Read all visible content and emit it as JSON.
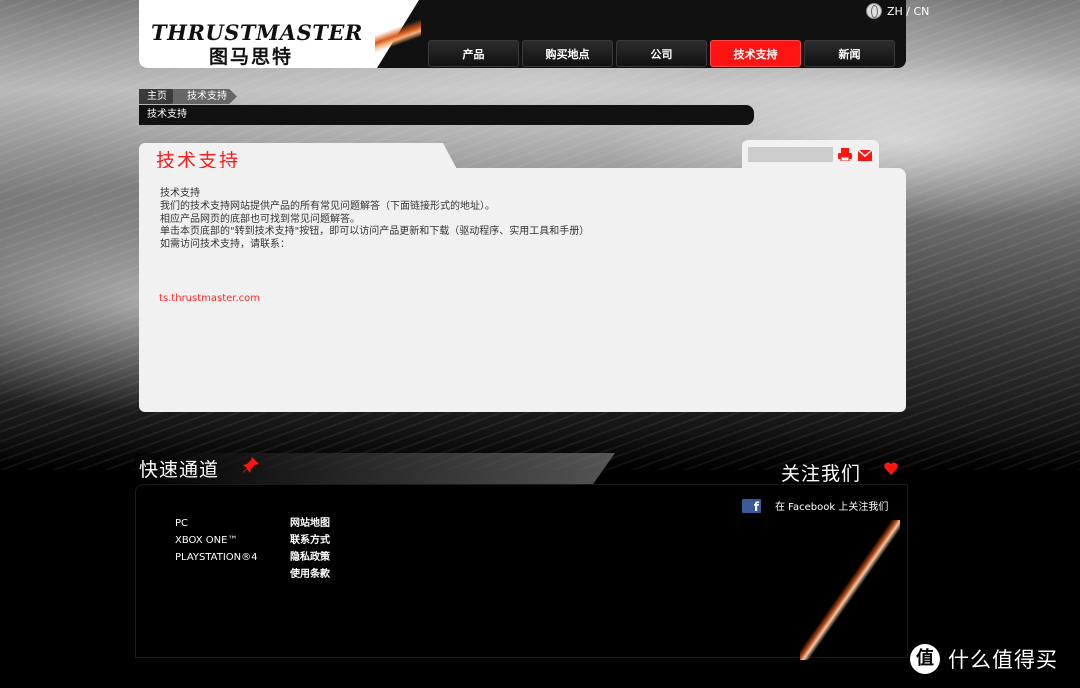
{
  "header": {
    "logo_en": "THRUSTMASTER",
    "logo_cn": "图马思特",
    "language": "ZH / CN",
    "nav": [
      {
        "label": "产品",
        "active": false
      },
      {
        "label": "购买地点",
        "active": false
      },
      {
        "label": "公司",
        "active": false
      },
      {
        "label": "技术支持",
        "active": true
      },
      {
        "label": "新闻",
        "active": false
      }
    ]
  },
  "breadcrumb": {
    "home": "主页",
    "current": "技术支持",
    "title_bar": "技术支持"
  },
  "panel": {
    "title": "技术支持",
    "lines": [
      "技术支持",
      "我们的技术支持网站提供产品的所有常见问题解答（下面链接形式的地址）。",
      "相应产品网页的底部也可找到常见问题解答。",
      "单击本页底部的\"转到技术支持\"按钮，即可以访问产品更新和下载（驱动程序、实用工具和手册）",
      "如需访问技术支持，请联系："
    ],
    "link": "ts.thrustmaster.com"
  },
  "footer": {
    "quick_title": "快速通道",
    "follow_title": "关注我们",
    "products": [
      "PC",
      "XBOX ONE™",
      "PLAYSTATION®4"
    ],
    "links": [
      "网站地图",
      "联系方式",
      "隐私政策",
      "使用条款"
    ],
    "facebook_text": "在 Facebook 上关注我们"
  },
  "watermark": {
    "badge": "值",
    "text": "什么值得买"
  },
  "colors": {
    "accent": "#ff1414",
    "panel_bg": "#f1f1f1",
    "facebook": "#3b5998"
  }
}
